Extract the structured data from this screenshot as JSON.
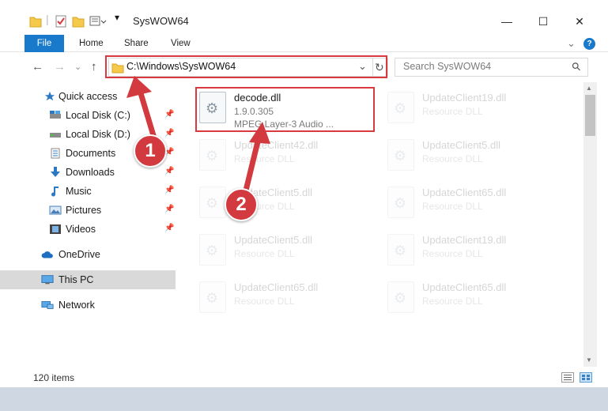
{
  "window": {
    "title": "SysWOW64",
    "minimize_glyph": "—",
    "maximize_glyph": "☐",
    "close_glyph": "✕"
  },
  "ribbon": {
    "tabs": [
      {
        "label": "File"
      },
      {
        "label": "Home"
      },
      {
        "label": "Share"
      },
      {
        "label": "View"
      }
    ],
    "expand_glyph": "⌄",
    "help_glyph": "?"
  },
  "nav": {
    "back_glyph": "←",
    "forward_glyph": "→",
    "recent_glyph": "⌄",
    "up_glyph": "↑",
    "address": "C:\\Windows\\SysWOW64",
    "address_dropdown_glyph": "⌄",
    "refresh_glyph": "↻",
    "search_placeholder": "Search SysWOW64",
    "search_glyph": "⚲"
  },
  "sidebar": {
    "items": [
      {
        "label": "Quick access",
        "icon": "star-icon",
        "pinned": false
      },
      {
        "label": "Local Disk (C:)",
        "icon": "drive-icon",
        "pinned": true
      },
      {
        "label": "Local Disk (D:)",
        "icon": "drive-icon",
        "pinned": true
      },
      {
        "label": "Documents",
        "icon": "documents-icon",
        "pinned": true
      },
      {
        "label": "Downloads",
        "icon": "download-icon",
        "pinned": true
      },
      {
        "label": "Music",
        "icon": "music-icon",
        "pinned": true
      },
      {
        "label": "Pictures",
        "icon": "pictures-icon",
        "pinned": true
      },
      {
        "label": "Videos",
        "icon": "videos-icon",
        "pinned": true
      },
      {
        "label": "OneDrive",
        "icon": "cloud-icon",
        "pinned": false
      },
      {
        "label": "This PC",
        "icon": "computer-icon",
        "pinned": false,
        "selected": true
      },
      {
        "label": "Network",
        "icon": "network-icon",
        "pinned": false
      }
    ],
    "pin_glyph": "📌"
  },
  "files": [
    {
      "name": "decode.dll",
      "version": "1.9.0.305",
      "description": "MPEG Layer-3 Audio ...",
      "highlighted": true
    },
    {
      "name": "UpdateClient19.dll",
      "description": "Resource DLL"
    },
    {
      "name": "UpdateClient42.dll",
      "description": "Resource DLL"
    },
    {
      "name": "UpdateClient5.dll",
      "description": "Resource DLL"
    },
    {
      "name": "UpdateClient5.dll",
      "description": "Resource DLL"
    },
    {
      "name": "UpdateClient65.dll",
      "description": "Resource DLL"
    },
    {
      "name": "UpdateClient5.dll",
      "description": "Resource DLL"
    },
    {
      "name": "UpdateClient19.dll",
      "description": "Resource DLL"
    },
    {
      "name": "UpdateClient65.dll",
      "description": "Resource DLL"
    },
    {
      "name": "UpdateClient65.dll",
      "description": "Resource DLL"
    }
  ],
  "file_icon_glyph": "⚙",
  "status": {
    "item_count": "120 items"
  },
  "callouts": [
    {
      "label": "1"
    },
    {
      "label": "2"
    }
  ],
  "colors": {
    "accent": "#1979ca",
    "highlight": "#d9393f",
    "badge": "#d23a3f",
    "selected_bg": "#d9d9d9"
  }
}
